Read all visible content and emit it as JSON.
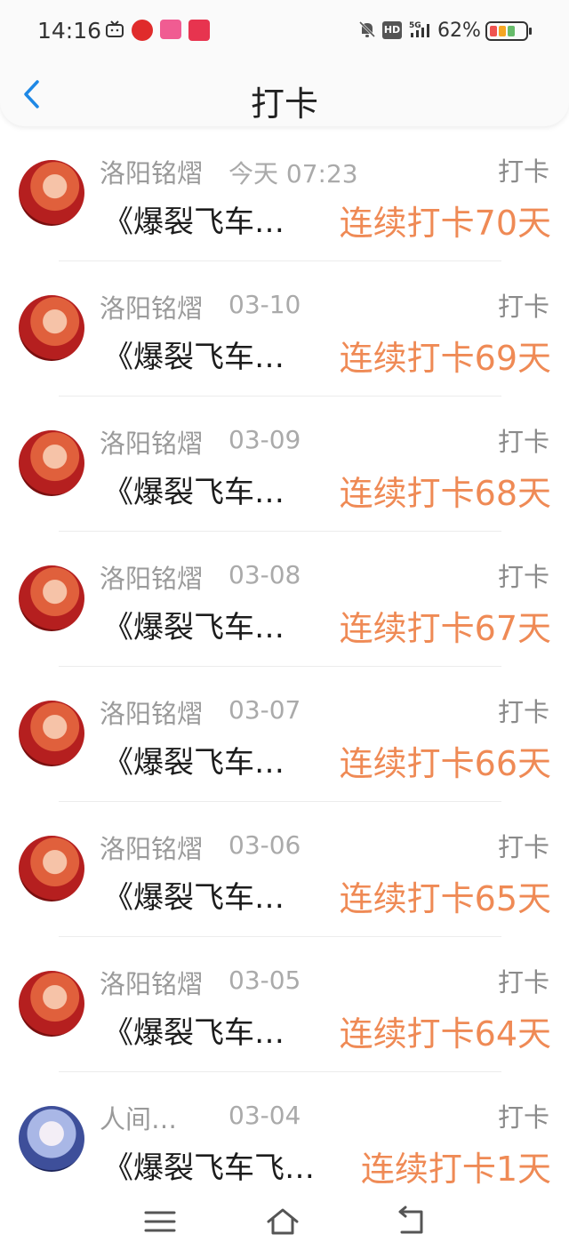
{
  "status_bar": {
    "time": "14:16",
    "battery_percent": "62%",
    "hd_label": "HD",
    "network": "5G",
    "icons": [
      "tv-icon",
      "netease-music-icon",
      "bilibili-icon",
      "heart-app-icon",
      "mute-bell-icon",
      "signal-icon",
      "battery-icon"
    ]
  },
  "header": {
    "title": "打卡",
    "back_icon": "chevron-left-icon"
  },
  "colors": {
    "accent": "#1e88e5",
    "streak": "#ef8a55",
    "muted_text": "#9a9a9a"
  },
  "checkins": [
    {
      "user": "洛阳铭熠",
      "date": "今天 07:23",
      "action": "打卡",
      "book": "《爆裂飞车…",
      "streak": "连续打卡70天"
    },
    {
      "user": "洛阳铭熠",
      "date": "03-10",
      "action": "打卡",
      "book": "《爆裂飞车…",
      "streak": "连续打卡69天"
    },
    {
      "user": "洛阳铭熠",
      "date": "03-09",
      "action": "打卡",
      "book": "《爆裂飞车…",
      "streak": "连续打卡68天"
    },
    {
      "user": "洛阳铭熠",
      "date": "03-08",
      "action": "打卡",
      "book": "《爆裂飞车…",
      "streak": "连续打卡67天"
    },
    {
      "user": "洛阳铭熠",
      "date": "03-07",
      "action": "打卡",
      "book": "《爆裂飞车…",
      "streak": "连续打卡66天"
    },
    {
      "user": "洛阳铭熠",
      "date": "03-06",
      "action": "打卡",
      "book": "《爆裂飞车…",
      "streak": "连续打卡65天"
    },
    {
      "user": "洛阳铭熠",
      "date": "03-05",
      "action": "打卡",
      "book": "《爆裂飞车…",
      "streak": "连续打卡64天"
    },
    {
      "user": "人间…",
      "date": "03-04",
      "action": "打卡",
      "book": "《爆裂飞车飞…",
      "streak": "连续打卡1天"
    }
  ],
  "nav_bar": {
    "icons": [
      "menu-icon",
      "home-icon",
      "back-icon"
    ]
  }
}
